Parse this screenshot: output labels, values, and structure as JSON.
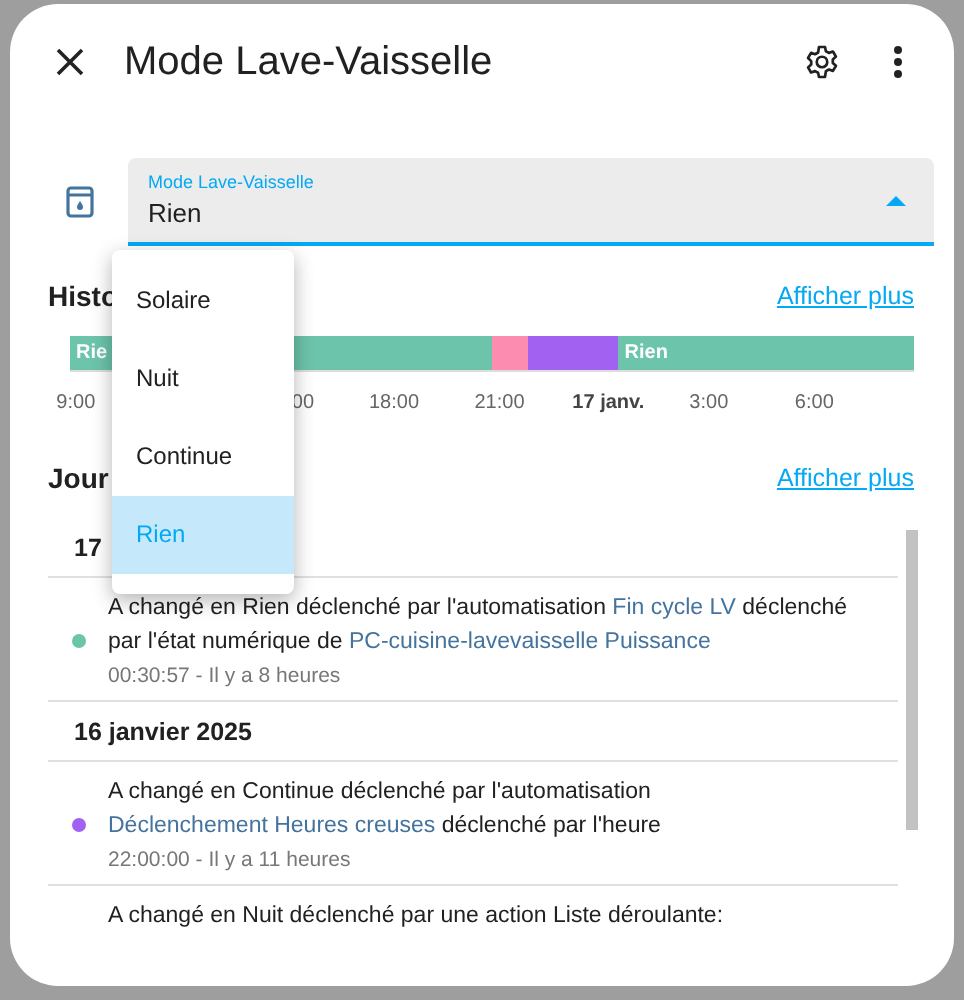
{
  "dialog": {
    "title": "Mode Lave-Vaisselle"
  },
  "select": {
    "label": "Mode Lave-Vaisselle",
    "value": "Rien",
    "expanded": true
  },
  "menu": [
    {
      "label": "Solaire",
      "selected": false
    },
    {
      "label": "Nuit",
      "selected": false
    },
    {
      "label": "Continue",
      "selected": false
    },
    {
      "label": "Rien",
      "selected": true
    }
  ],
  "history": {
    "title": "Histo",
    "link": "Afficher plus",
    "segments": [
      {
        "label": "Rie",
        "color": "#6cc4ab"
      },
      {
        "color": "#fc8db0"
      },
      {
        "color": "#a261f1"
      },
      {
        "label": "Rien",
        "color": "#6cc4ab"
      }
    ],
    "ticks": [
      {
        "label": "9:00",
        "bold": false
      },
      {
        "label": "00",
        "bold": false
      },
      {
        "label": "18:00",
        "bold": false
      },
      {
        "label": "21:00",
        "bold": false
      },
      {
        "label": "17 janv.",
        "bold": true
      },
      {
        "label": "3:00",
        "bold": false
      },
      {
        "label": "6:00",
        "bold": false
      }
    ]
  },
  "logbook": {
    "title": "Jour",
    "link": "Afficher plus",
    "groups": [
      {
        "date": "17",
        "entries": [
          {
            "color": "#6cc4ab",
            "time": "00:30:57 - Il y a 8 heures",
            "parts": [
              {
                "kind": "text",
                "text": "A changé en Rien déclenché par l'automatisation "
              },
              {
                "kind": "link",
                "text": "Fin cycle LV"
              },
              {
                "kind": "text",
                "text": " déclenché par l'état numérique de "
              },
              {
                "kind": "link",
                "text": "PC-cuisine-lavevaisselle Puissance"
              }
            ]
          }
        ]
      },
      {
        "date": "16 janvier 2025",
        "entries": [
          {
            "color": "#a261f1",
            "time": "22:00:00 - Il y a 11 heures",
            "parts": [
              {
                "kind": "text",
                "text": "A changé en Continue déclenché par l'automatisation "
              },
              {
                "kind": "link",
                "text": "Déclenchement Heures creuses"
              },
              {
                "kind": "text",
                "text": " déclenché par l'heure"
              }
            ]
          },
          {
            "parts": [
              {
                "kind": "text",
                "text": "A changé en Nuit déclenché par une action Liste déroulante:"
              }
            ]
          }
        ]
      }
    ]
  }
}
